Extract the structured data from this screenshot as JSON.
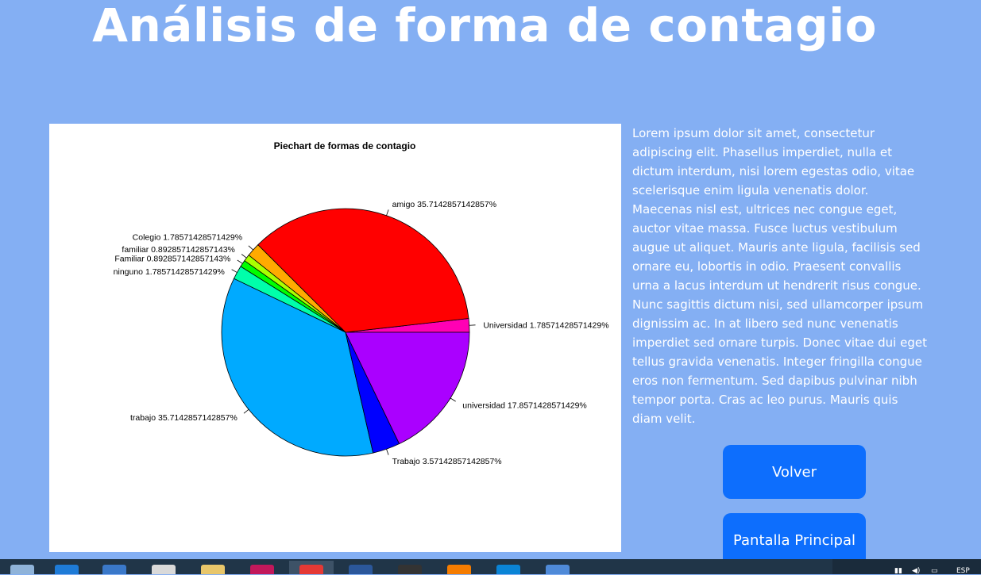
{
  "page": {
    "title": "Análisis de forma de contagio",
    "body_text": "Lorem ipsum dolor sit amet, consectetur adipiscing elit. Phasellus imperdiet, nulla et dictum interdum, nisi lorem egestas odio, vitae scelerisque enim ligula venenatis dolor. Maecenas nisl est, ultrices nec congue eget, auctor vitae massa. Fusce luctus vestibulum augue ut aliquet. Mauris ante ligula, facilisis sed ornare eu, lobortis in odio. Praesent convallis urna a lacus interdum ut hendrerit risus congue. Nunc sagittis dictum nisi, sed ullamcorper ipsum dignissim ac. In at libero sed nunc venenatis imperdiet sed ornare turpis. Donec vitae dui eget tellus gravida venenatis. Integer fringilla congue eros non fermentum. Sed dapibus pulvinar nibh tempor porta. Cras ac leo purus. Mauris quis diam velit."
  },
  "buttons": {
    "back_label": "Volver",
    "main_label": "Pantalla Principal"
  },
  "colors": {
    "background": "#84aff3",
    "button": "#0d6efd"
  },
  "taskbar": {
    "icons": [
      "task-manager-icon",
      "mail-icon",
      "keyboard-app-icon",
      "media-app-icon",
      "file-explorer-icon",
      "opera-gx-icon",
      "opera-icon",
      "word-icon",
      "terminal-icon",
      "xampp-icon",
      "vscode-icon",
      "r-icon"
    ],
    "tray_text": "ESP"
  },
  "chart_data": {
    "type": "pie",
    "title": "Piechart de formas de contagio",
    "slices": [
      {
        "label": "Universidad 1.78571428571429%",
        "value": 1.78571428571429,
        "color": "#ff00b4"
      },
      {
        "label": "amigo 35.7142857142857%",
        "value": 35.7142857142857,
        "color": "#ff0000"
      },
      {
        "label": "Colegio 1.78571428571429%",
        "value": 1.78571428571429,
        "color": "#ffaa00"
      },
      {
        "label": "familiar 0.892857142857143%",
        "value": 0.892857142857143,
        "color": "#aaff00"
      },
      {
        "label": "Familiar 0.892857142857143%",
        "value": 0.892857142857143,
        "color": "#00ff00"
      },
      {
        "label": "ninguno 1.78571428571429%",
        "value": 1.78571428571429,
        "color": "#00ffaa"
      },
      {
        "label": "trabajo 35.7142857142857%",
        "value": 35.7142857142857,
        "color": "#00aaff"
      },
      {
        "label": "Trabajo 3.57142857142857%",
        "value": 3.57142857142857,
        "color": "#0000ff"
      },
      {
        "label": "universidad 17.8571428571429%",
        "value": 17.8571428571429,
        "color": "#aa00ff"
      }
    ]
  }
}
